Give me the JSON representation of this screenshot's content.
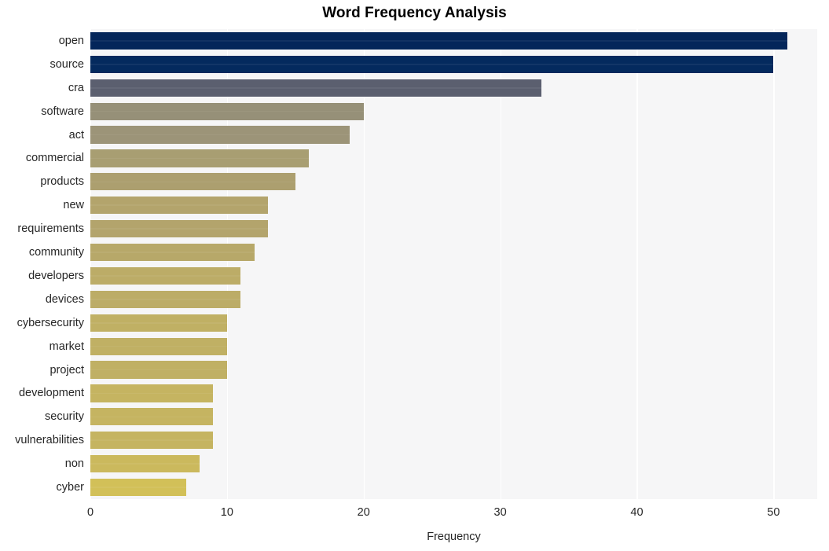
{
  "chart_data": {
    "type": "bar",
    "orientation": "horizontal",
    "title": "Word Frequency Analysis",
    "xlabel": "Frequency",
    "ylabel": "",
    "categories": [
      "open",
      "source",
      "cra",
      "software",
      "act",
      "commercial",
      "products",
      "new",
      "requirements",
      "community",
      "developers",
      "devices",
      "cybersecurity",
      "market",
      "project",
      "development",
      "security",
      "vulnerabilities",
      "non",
      "cyber"
    ],
    "values": [
      51,
      50,
      33,
      20,
      19,
      16,
      15,
      13,
      13,
      12,
      11,
      11,
      10,
      10,
      10,
      9,
      9,
      9,
      8,
      7
    ],
    "bar_colors": [
      "#04265a",
      "#042a5e",
      "#5b5f6f",
      "#969078",
      "#9c9478",
      "#a89e72",
      "#ac9f6f",
      "#b3a46c",
      "#b3a46c",
      "#b7a869",
      "#bcac67",
      "#bcac67",
      "#c0b064",
      "#c0b064",
      "#c0b064",
      "#c5b461",
      "#c5b461",
      "#c5b461",
      "#cbb95d",
      "#d2c058"
    ],
    "xticks": [
      0,
      10,
      20,
      30,
      40,
      50
    ],
    "xlim": [
      0,
      53.2
    ],
    "grid": true,
    "grid_axis": "x",
    "legend": "none",
    "plot_background": "#f6f6f7",
    "figure_background": "#ffffff",
    "gridline_color": "#ffffff"
  }
}
